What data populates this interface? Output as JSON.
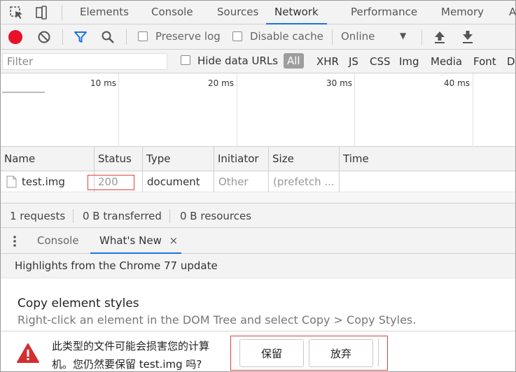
{
  "tabs": {
    "elements": "Elements",
    "console": "Console",
    "sources": "Sources",
    "network": "Network",
    "performance": "Performance",
    "memory": "Memory",
    "more": "A"
  },
  "toolbar": {
    "preserve_log": "Preserve log",
    "disable_cache": "Disable cache",
    "throttle": "Online",
    "throttle_arrow": "▼"
  },
  "filter": {
    "placeholder": "Filter",
    "hide_data_urls": "Hide data URLs",
    "types": [
      "All",
      "XHR",
      "JS",
      "CSS",
      "Img",
      "Media",
      "Font",
      "D"
    ]
  },
  "overview": {
    "ticks": [
      "10 ms",
      "20 ms",
      "30 ms",
      "40 ms"
    ]
  },
  "table": {
    "headers": [
      "Name",
      "Status",
      "Type",
      "Initiator",
      "Size",
      "Time"
    ],
    "rows": [
      {
        "name": "test.img",
        "status": "200",
        "type": "document",
        "initiator": "Other",
        "size": "(prefetch ...",
        "time": ""
      }
    ]
  },
  "summary": {
    "requests": "1 requests",
    "transferred": "0 B transferred",
    "resources": "0 B resources"
  },
  "drawer": {
    "console": "Console",
    "whats_new": "What's New",
    "close": "×"
  },
  "whats_new": {
    "highlights": "Highlights from the Chrome 77 update",
    "title": "Copy element styles",
    "description": "Right-click an element in the DOM Tree and select Copy > Copy Styles."
  },
  "download": {
    "line1": "此类型的文件可能会损害您的计算",
    "line2": "机。您仍然要保留 test.img 吗?",
    "keep": "保留",
    "discard": "放弃"
  },
  "colors": {
    "record": "#e8102b",
    "accent": "#1a73e8",
    "highlight_box": "#e04040",
    "warning": "#d32f2f"
  }
}
